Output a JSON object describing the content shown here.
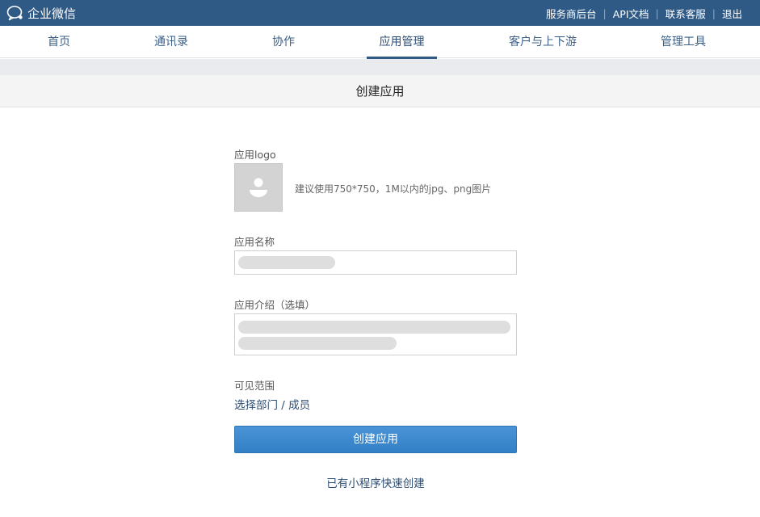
{
  "topbar": {
    "brand": "企业微信",
    "links": [
      "服务商后台",
      "API文档",
      "联系客服",
      "退出"
    ],
    "separator": "|"
  },
  "nav": {
    "tabs": [
      "首页",
      "通讯录",
      "协作",
      "应用管理",
      "客户与上下游",
      "管理工具"
    ],
    "active": "应用管理"
  },
  "page": {
    "title": "创建应用"
  },
  "form": {
    "logo_label": "应用logo",
    "logo_hint": "建议使用750*750，1M以内的jpg、png图片",
    "name_label": "应用名称",
    "name_value": "",
    "intro_label": "应用介绍（选填）",
    "intro_value": "",
    "visibility_label": "可见范围",
    "visibility_link": "选择部门 / 成员",
    "submit_label": "创建应用",
    "mini_program_link": "已有小程序快速创建"
  },
  "colors": {
    "topbar": "#2f5a86",
    "primary_button": "#3a86cc",
    "link": "#2d4e74"
  }
}
